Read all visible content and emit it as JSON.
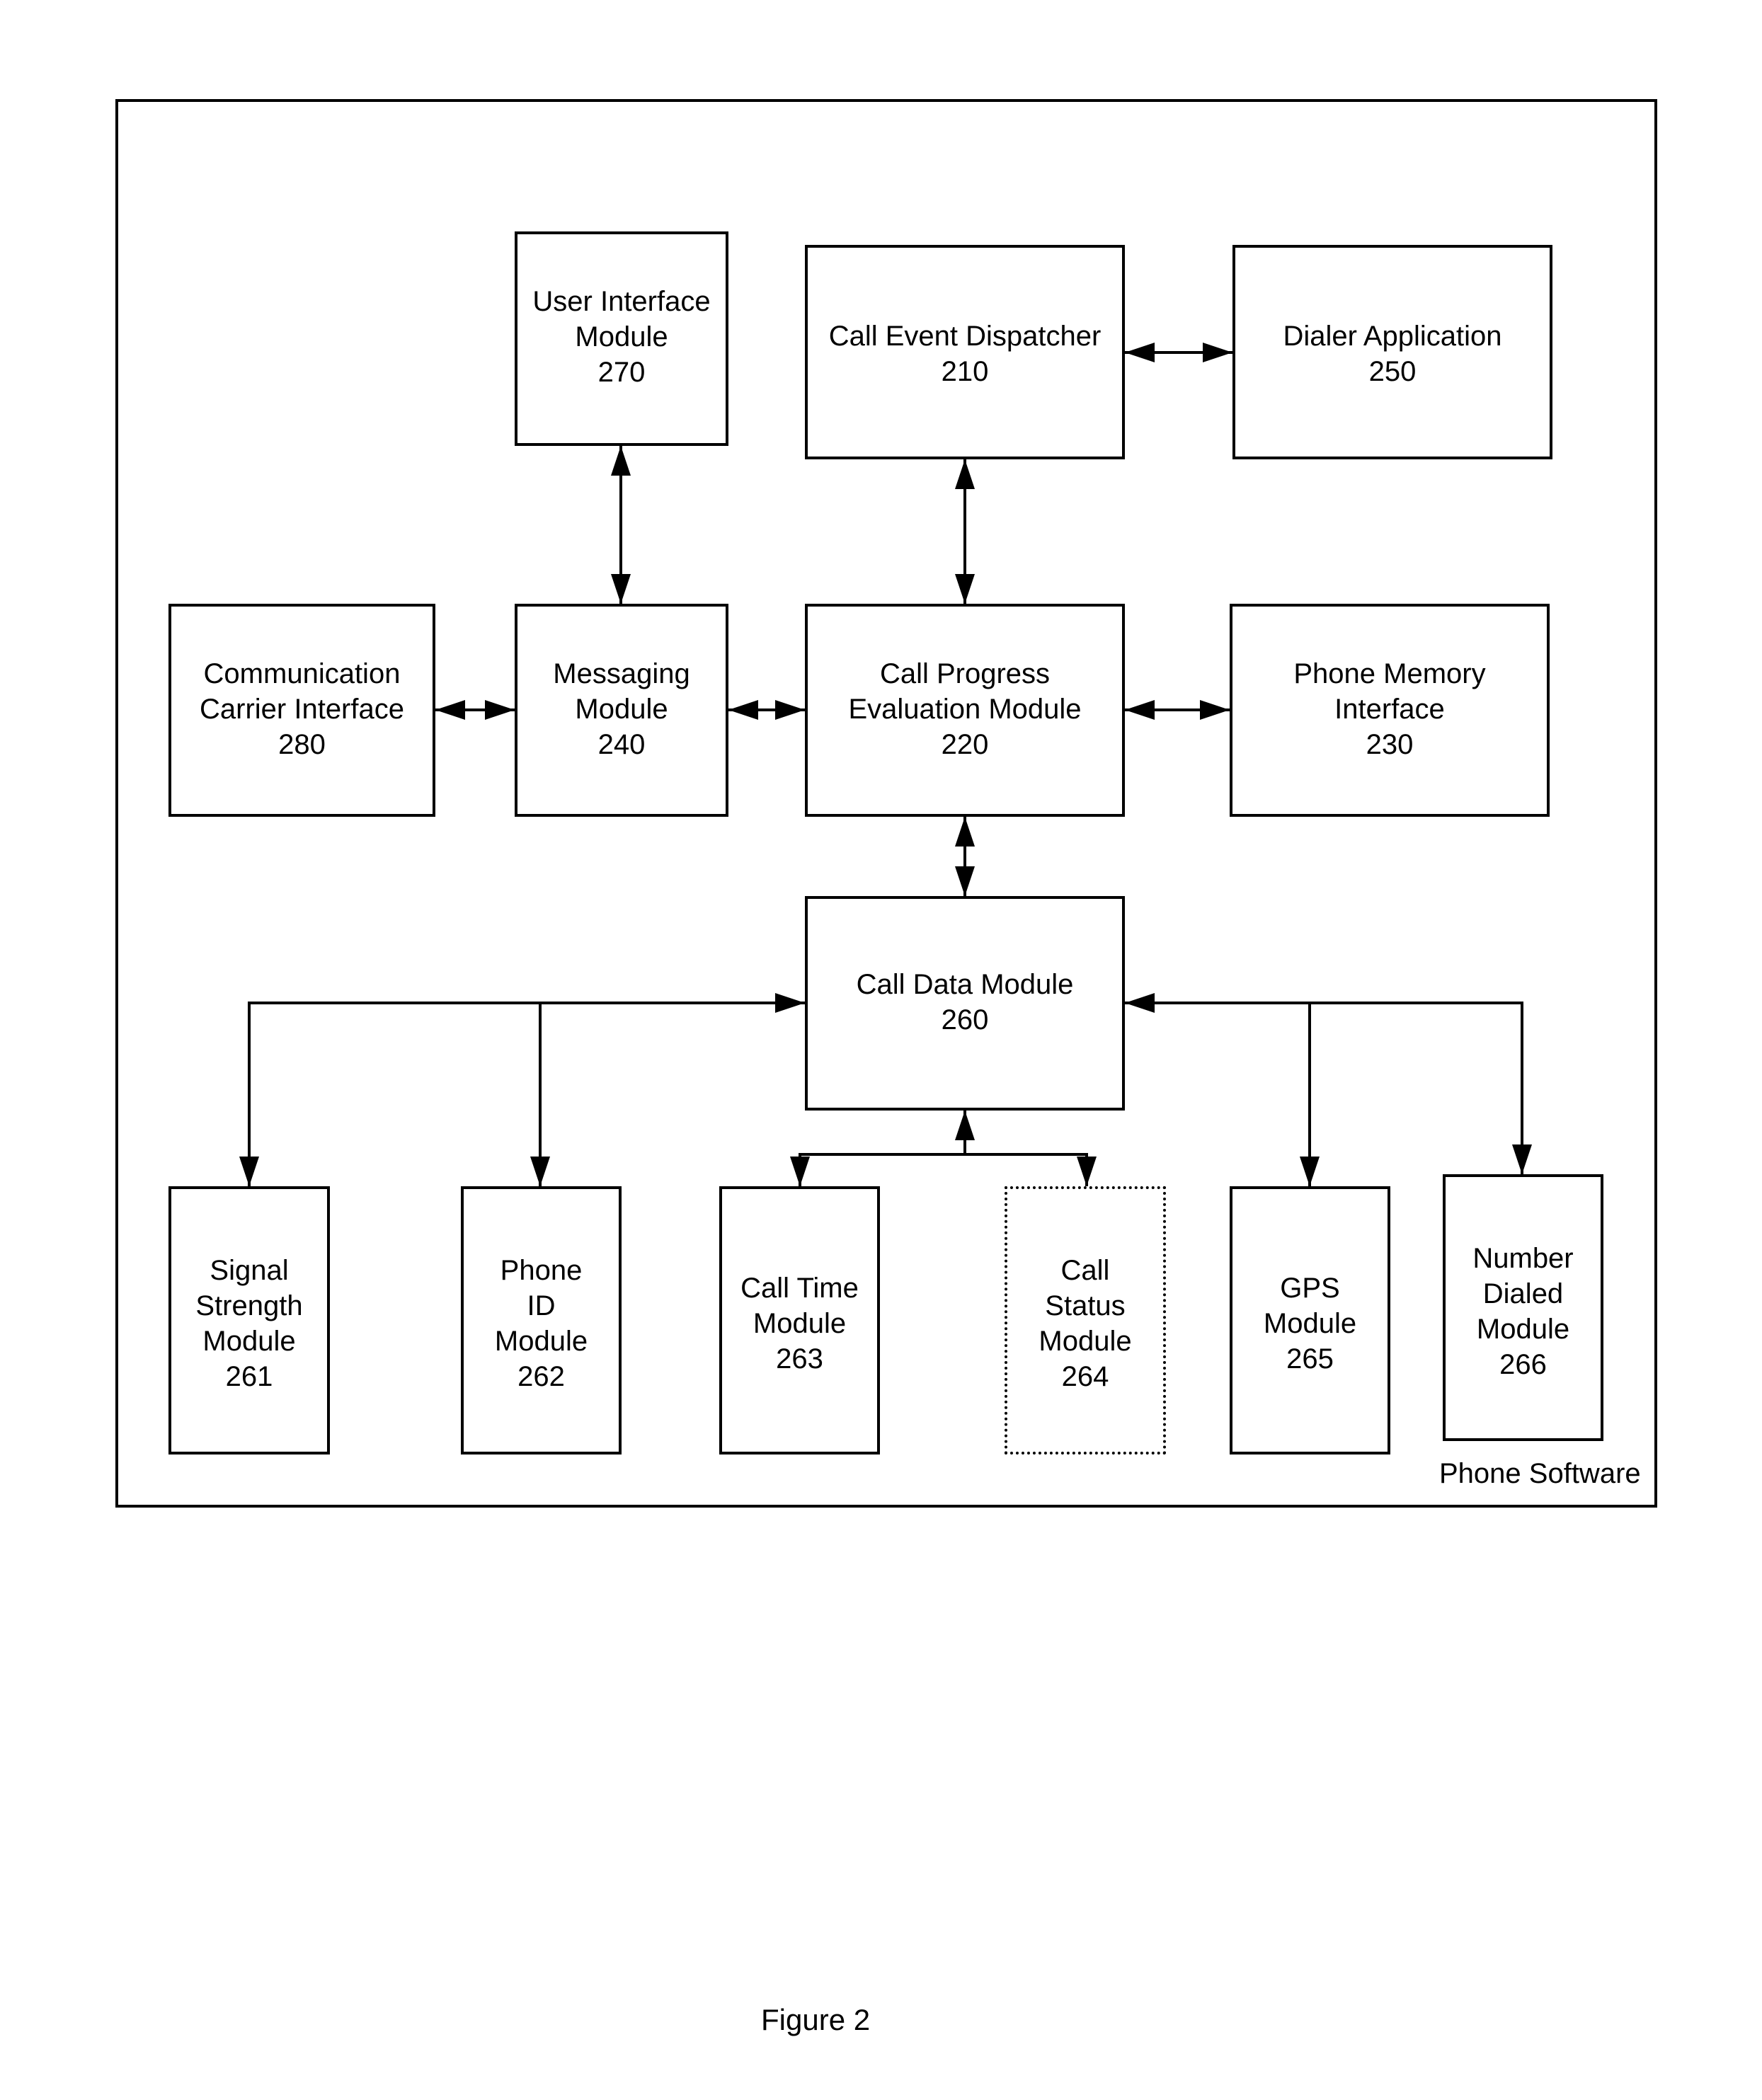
{
  "figure": {
    "caption": "Figure 2",
    "container_label": "Phone Software"
  },
  "modules": {
    "m270": {
      "name": "User Interface\nModule",
      "number": "270"
    },
    "m210": {
      "name": "Call Event Dispatcher",
      "number": "210"
    },
    "m250": {
      "name": "Dialer Application",
      "number": "250"
    },
    "m280": {
      "name": "Communication\nCarrier Interface",
      "number": "280"
    },
    "m240": {
      "name": "Messaging\nModule",
      "number": "240"
    },
    "m220": {
      "name": "Call Progress\nEvaluation Module",
      "number": "220"
    },
    "m230": {
      "name": "Phone Memory\nInterface",
      "number": "230"
    },
    "m260": {
      "name": "Call Data Module",
      "number": "260"
    },
    "m261": {
      "name": "Signal\nStrength\nModule",
      "number": "261"
    },
    "m262": {
      "name": "Phone\nID\nModule",
      "number": "262"
    },
    "m263": {
      "name": "Call Time\nModule",
      "number": "263"
    },
    "m264": {
      "name": "Call\nStatus\nModule",
      "number": "264"
    },
    "m265": {
      "name": "GPS\nModule",
      "number": "265"
    },
    "m266": {
      "name": "Number\nDialed\nModule",
      "number": "266"
    }
  },
  "connections": [
    {
      "from": "270",
      "to": "240",
      "type": "bidirectional"
    },
    {
      "from": "210",
      "to": "250",
      "type": "bidirectional"
    },
    {
      "from": "210",
      "to": "220",
      "type": "bidirectional"
    },
    {
      "from": "280",
      "to": "240",
      "type": "bidirectional"
    },
    {
      "from": "240",
      "to": "220",
      "type": "bidirectional"
    },
    {
      "from": "220",
      "to": "230",
      "type": "bidirectional"
    },
    {
      "from": "220",
      "to": "260",
      "type": "bidirectional"
    },
    {
      "from": "260",
      "to": "261",
      "type": "bidirectional"
    },
    {
      "from": "260",
      "to": "262",
      "type": "bidirectional"
    },
    {
      "from": "260",
      "to": "263",
      "type": "bidirectional"
    },
    {
      "from": "260",
      "to": "264",
      "type": "bidirectional"
    },
    {
      "from": "260",
      "to": "265",
      "type": "bidirectional"
    },
    {
      "from": "260",
      "to": "266",
      "type": "bidirectional"
    }
  ]
}
